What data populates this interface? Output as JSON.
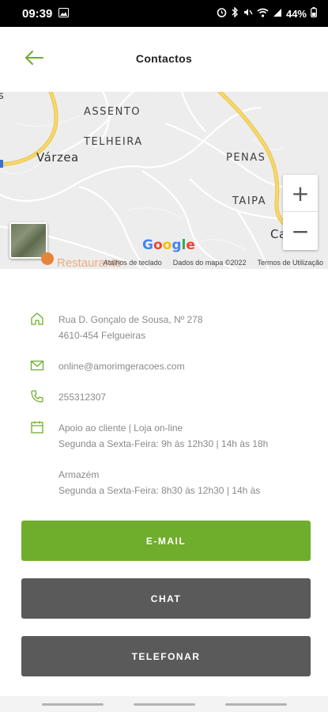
{
  "status_bar": {
    "time": "09:39",
    "battery": "44%"
  },
  "header": {
    "title": "Contactos",
    "back_icon": "arrow-left-icon"
  },
  "map": {
    "labels": {
      "assento": "ASSENTO",
      "telheira": "TELHEIRA",
      "varzea": "Várzea",
      "penas": "PENAS",
      "taipa": "TAIPA",
      "calhos": "Ca",
      "s_edge": "s"
    },
    "zoom_in": "+",
    "zoom_out": "−",
    "google": "Google",
    "footer": {
      "shortcuts": "Atalhos de teclado",
      "map_data": "Dados do mapa ©2022",
      "terms": "Termos de Utilização"
    },
    "pin_label": "Restaurante"
  },
  "contact": {
    "address_line1": "Rua D. Gonçalo de Sousa, Nº 278",
    "address_line2": "4610-454 Felgueiras",
    "email": "online@amorimgeracoes.com",
    "phone": "255312307",
    "support_title": "Apoio ao cliente | Loja on-line",
    "support_hours": "Segunda a Sexta-Feira: 9h às 12h30 | 14h às 18h",
    "warehouse_title": "Armazém",
    "warehouse_hours": "Segunda a Sexta-Feira: 8h30 às 12h30 | 14h às"
  },
  "buttons": {
    "email": "E-MAIL",
    "chat": "CHAT",
    "phone": "TELEFONAR"
  },
  "colors": {
    "accent": "#6fad2c",
    "dark_button": "#5a5a5a"
  }
}
